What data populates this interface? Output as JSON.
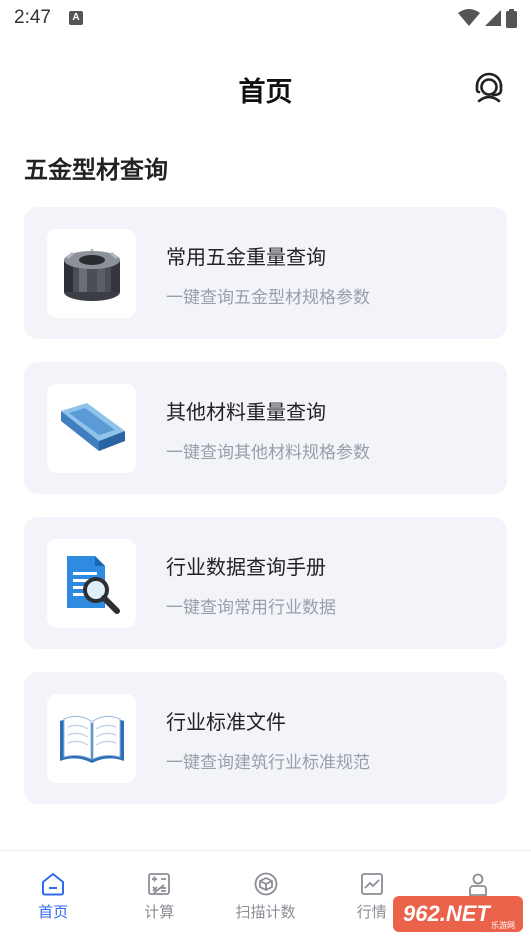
{
  "status_bar": {
    "time": "2:47",
    "notification_letter": "A"
  },
  "header": {
    "title": "首页",
    "support_icon": "customer-service-icon"
  },
  "section": {
    "title": "五金型材查询"
  },
  "cards": [
    {
      "title": "常用五金重量查询",
      "subtitle": "一键查询五金型材规格参数",
      "icon": "hex-nut-icon"
    },
    {
      "title": "其他材料重量查询",
      "subtitle": "一键查询其他材料规格参数",
      "icon": "channel-steel-icon"
    },
    {
      "title": "行业数据查询手册",
      "subtitle": "一键查询常用行业数据",
      "icon": "document-search-icon"
    },
    {
      "title": "行业标准文件",
      "subtitle": "一键查询建筑行业标准规范",
      "icon": "open-book-icon"
    }
  ],
  "tabs": [
    {
      "label": "首页",
      "icon": "home-icon",
      "active": true
    },
    {
      "label": "计算",
      "icon": "calculator-icon",
      "active": false
    },
    {
      "label": "扫描计数",
      "icon": "scan-box-icon",
      "active": false
    },
    {
      "label": "行情",
      "icon": "trend-chart-icon",
      "active": false
    },
    {
      "label": "",
      "icon": "user-icon",
      "active": false
    }
  ],
  "watermark": {
    "text": "962.NET",
    "subtext": "乐游网"
  },
  "colors": {
    "accent": "#2f6bf2",
    "card_bg": "#f2f4f9",
    "subtitle": "#9a9ea6"
  }
}
